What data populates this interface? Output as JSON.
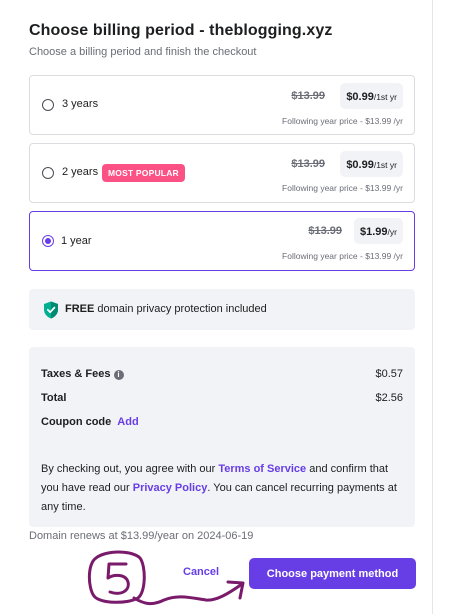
{
  "header": {
    "title": "Choose billing period - theblogging.xyz",
    "subtitle": "Choose a billing period and finish the checkout"
  },
  "periods": [
    {
      "label": "3 years",
      "badge": "",
      "old_price": "$13.99",
      "price": "$0.99",
      "unit": "/1st yr",
      "following": "Following year price - $13.99 /yr",
      "selected": false
    },
    {
      "label": "2 years",
      "badge": "MOST POPULAR",
      "old_price": "$13.99",
      "price": "$0.99",
      "unit": "/1st yr",
      "following": "Following year price - $13.99 /yr",
      "selected": false
    },
    {
      "label": "1 year",
      "badge": "",
      "old_price": "$13.99",
      "price": "$1.99",
      "unit": "/yr",
      "following": "Following year price - $13.99 /yr",
      "selected": true
    }
  ],
  "privacy": {
    "icon": "shield-check-icon",
    "bold": "FREE",
    "text": " domain privacy protection included"
  },
  "summary": {
    "taxes_label": "Taxes & Fees",
    "taxes_value": "$0.57",
    "total_label": "Total",
    "total_value": "$2.56",
    "coupon_label": "Coupon code",
    "coupon_link": "Add",
    "terms_prefix": "By checking out, you agree with our ",
    "terms_link": "Terms of Service",
    "terms_middle": " and confirm that you have read our ",
    "privacy_link": "Privacy Policy",
    "terms_suffix": ". You can cancel recurring payments at any time."
  },
  "renews": "Domain renews at $13.99/year on 2024-06-19",
  "actions": {
    "cancel_label": "Cancel",
    "pay_label": "Choose payment method"
  },
  "colors": {
    "accent": "#673de6",
    "badge": "#fc5185",
    "shield": "#00b090",
    "annotation": "#7a1a6b"
  }
}
